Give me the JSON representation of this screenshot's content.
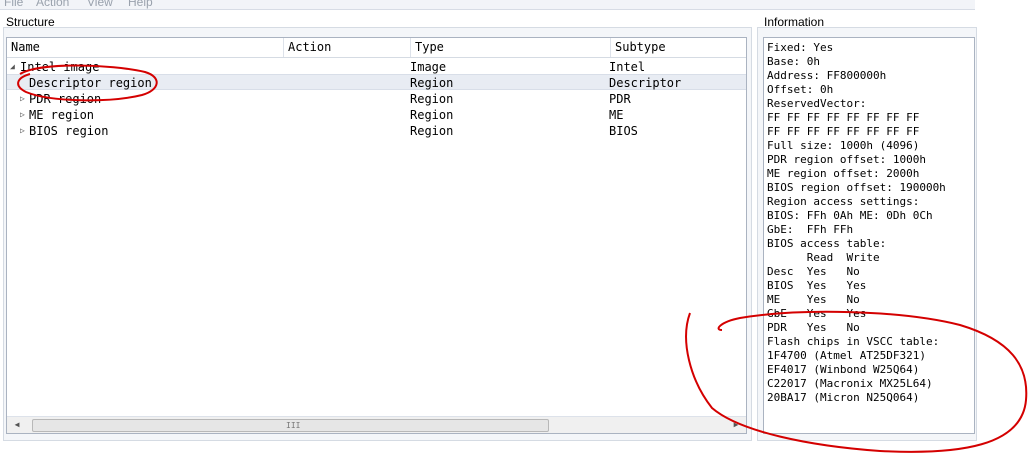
{
  "menu": [
    "File",
    "Action",
    "View",
    "Help"
  ],
  "structure_label": "Structure",
  "information_label": "Information",
  "columns": [
    "Name",
    "Action",
    "Type",
    "Subtype"
  ],
  "rows": [
    {
      "name": "Intel image",
      "action": "",
      "type": "Image",
      "subtype": "Intel",
      "expander": "expanded"
    },
    {
      "name": "Descriptor region",
      "action": "",
      "type": "Region",
      "subtype": "Descriptor",
      "expander": "none"
    },
    {
      "name": "PDR region",
      "action": "",
      "type": "Region",
      "subtype": "PDR",
      "expander": "collapsed"
    },
    {
      "name": "ME region",
      "action": "",
      "type": "Region",
      "subtype": "ME",
      "expander": "collapsed"
    },
    {
      "name": "BIOS region",
      "action": "",
      "type": "Region",
      "subtype": "BIOS",
      "expander": "collapsed"
    }
  ],
  "information_lines": [
    "Fixed: Yes",
    "Base: 0h",
    "Address: FF800000h",
    "Offset: 0h",
    "ReservedVector:",
    "FF FF FF FF FF FF FF FF",
    "FF FF FF FF FF FF FF FF",
    "Full size: 1000h (4096)",
    "PDR region offset: 1000h",
    "ME region offset: 2000h",
    "BIOS region offset: 190000h",
    "Region access settings:",
    "BIOS: FFh 0Ah ME: 0Dh 0Ch",
    "GbE:  FFh FFh",
    "BIOS access table:",
    "      Read  Write",
    "Desc  Yes   No",
    "BIOS  Yes   Yes",
    "ME    Yes   No",
    "GbE   Yes   Yes",
    "PDR   Yes   No",
    "Flash chips in VSCC table:",
    "1F4700 (Atmel AT25DF321)",
    "EF4017 (Winbond W25Q64)",
    "C22017 (Macronix MX25L64)",
    "20BA17 (Micron N25Q064)"
  ],
  "scrollbar_grip": "III",
  "annotation_color": "#d40000"
}
